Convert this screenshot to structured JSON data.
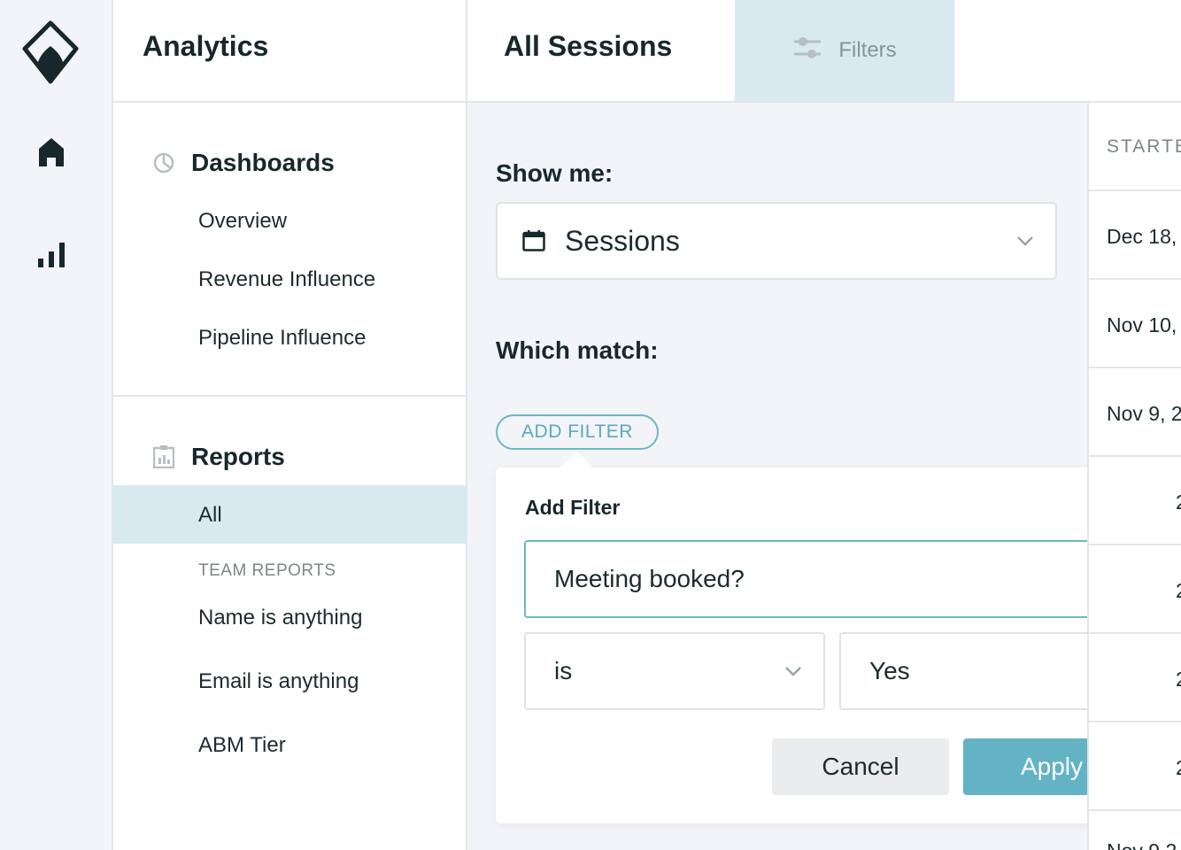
{
  "app": {
    "title": "Analytics"
  },
  "rail": {
    "icons": [
      "logo-icon",
      "home-icon",
      "bar-chart-icon"
    ]
  },
  "sidebar": {
    "dashboards": {
      "heading": "Dashboards",
      "items": [
        {
          "label": "Overview"
        },
        {
          "label": "Revenue Influence"
        },
        {
          "label": "Pipeline Influence"
        }
      ]
    },
    "reports": {
      "heading": "Reports",
      "active_item": "All",
      "team_caption": "TEAM REPORTS",
      "team_items": [
        {
          "label": "Name is anything"
        },
        {
          "label": "Email is anything"
        },
        {
          "label": "ABM Tier"
        }
      ]
    }
  },
  "header": {
    "page_title": "All Sessions",
    "filters_tab": "Filters"
  },
  "filter_panel": {
    "show_me_label": "Show me:",
    "show_me_value": "Sessions",
    "which_match_label": "Which match:",
    "add_filter_button": "ADD FILTER"
  },
  "popover": {
    "title": "Add Filter",
    "field": "Meeting booked?",
    "operator": "is",
    "value": "Yes",
    "cancel_label": "Cancel",
    "apply_label": "Apply"
  },
  "table": {
    "column_header": "STARTE",
    "rows": [
      "Dec 18,",
      "Nov 10,",
      "Nov 9, 2",
      "2",
      "2",
      "2",
      "2",
      "Nov 9 2"
    ]
  },
  "colors": {
    "accent": "#63b3c4",
    "active_bg": "#d8eaf0",
    "text_dark": "#16282b"
  }
}
